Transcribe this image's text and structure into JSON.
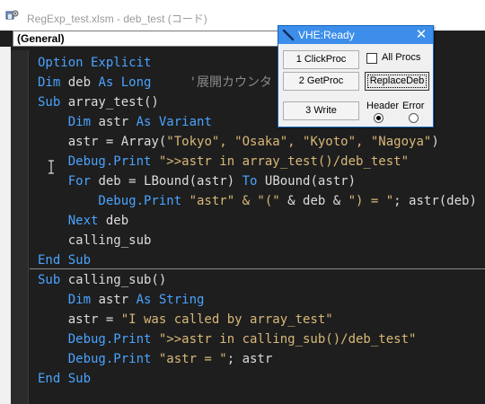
{
  "window": {
    "title": "RegExp_test.xlsm - deb_test (コード)",
    "app_icon": "vba-editor-icon"
  },
  "object_combo": {
    "value": "(General)"
  },
  "code_lines": [
    [
      {
        "t": "Option Explicit",
        "c": "kw"
      }
    ],
    [
      {
        "t": "Dim ",
        "c": "kw"
      },
      {
        "t": "deb ",
        "c": ""
      },
      {
        "t": "As Long",
        "c": "kw"
      },
      {
        "t": "     '展開カウンタ",
        "c": "cm"
      }
    ],
    [
      {
        "t": "Sub ",
        "c": "kw"
      },
      {
        "t": "array_test()",
        "c": ""
      }
    ],
    [
      {
        "t": "    Dim ",
        "c": "kw"
      },
      {
        "t": "astr ",
        "c": ""
      },
      {
        "t": "As Variant",
        "c": "kw"
      }
    ],
    [
      {
        "t": "    astr = Array(",
        "c": ""
      },
      {
        "t": "\"Tokyo\", \"Osaka\", \"Kyoto\", \"Nagoya\"",
        "c": "st"
      },
      {
        "t": ")",
        "c": ""
      }
    ],
    [
      {
        "t": "    Debug.Print ",
        "c": "kw"
      },
      {
        "t": "\">>astr in array_test()/deb_test\"",
        "c": "st"
      }
    ],
    [
      {
        "t": "    For ",
        "c": "kw"
      },
      {
        "t": "deb = LBound(astr) ",
        "c": ""
      },
      {
        "t": "To ",
        "c": "kw"
      },
      {
        "t": "UBound(astr)",
        "c": ""
      }
    ],
    [
      {
        "t": "        Debug.Print ",
        "c": "kw"
      },
      {
        "t": "\"astr\" & \"(\" ",
        "c": "st"
      },
      {
        "t": "& deb & ",
        "c": ""
      },
      {
        "t": "\") = \"",
        "c": "st"
      },
      {
        "t": "; astr(deb)",
        "c": ""
      }
    ],
    [
      {
        "t": "    Next ",
        "c": "kw"
      },
      {
        "t": "deb",
        "c": ""
      }
    ],
    [
      {
        "t": "    calling_sub",
        "c": ""
      }
    ],
    [
      {
        "t": "End Sub",
        "c": "kw"
      }
    ],
    [
      {
        "t": "Sub ",
        "c": "kw"
      },
      {
        "t": "calling_sub()",
        "c": ""
      }
    ],
    [
      {
        "t": "    Dim ",
        "c": "kw"
      },
      {
        "t": "astr ",
        "c": ""
      },
      {
        "t": "As String",
        "c": "kw"
      }
    ],
    [
      {
        "t": "    astr = ",
        "c": ""
      },
      {
        "t": "\"I was called by array_test\"",
        "c": "st"
      }
    ],
    [
      {
        "t": "    Debug.Print ",
        "c": "kw"
      },
      {
        "t": "\">>astr in calling_sub()/deb_test\"",
        "c": "st"
      }
    ],
    [
      {
        "t": "    Debug.Print ",
        "c": "kw"
      },
      {
        "t": "\"astr = \"",
        "c": "st"
      },
      {
        "t": "; astr",
        "c": ""
      }
    ],
    [
      {
        "t": "End Sub",
        "c": "kw"
      }
    ]
  ],
  "vhe": {
    "title": "VHE:Ready",
    "close_label": "✕",
    "buttons": {
      "click_proc": "1 ClickProc",
      "get_proc": "2 GetProc",
      "write": "3  Write",
      "replace_deb": "ReplaceDeb"
    },
    "all_procs_label": "All Procs",
    "all_procs_checked": false,
    "header_label": "Header",
    "error_label": "Error",
    "output_selected": "Header"
  },
  "colors": {
    "keyword": "#4aa3ff",
    "string": "#d8b878",
    "comment": "#8a8a8a",
    "code_bg": "#1e1e1e",
    "vhe_title_bg": "#3d8eea"
  }
}
